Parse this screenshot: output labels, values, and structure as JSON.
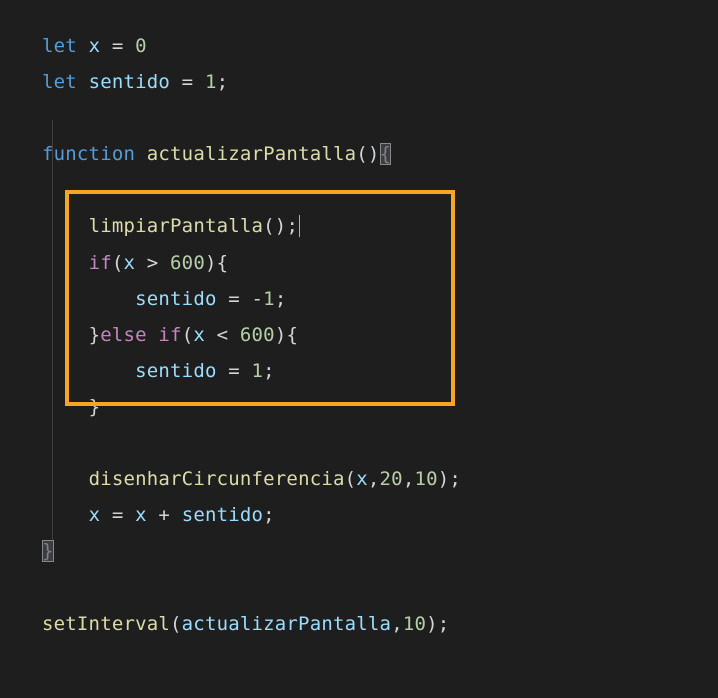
{
  "code": {
    "l1_let": "let",
    "l1_var": "x",
    "l1_eq": " = ",
    "l1_val": "0",
    "l2_let": "let",
    "l2_var": "sentido",
    "l2_eq": " = ",
    "l2_val": "1",
    "l2_semi": ";",
    "l4_func": "function",
    "l4_name": "actualizarPantalla",
    "l4_parens": "()",
    "l4_brace": "{",
    "l6_call": "limpiarPantalla",
    "l6_parens": "()",
    "l6_semi": ";",
    "l7_if": "if",
    "l7_open": "(",
    "l7_var": "x",
    "l7_op": " > ",
    "l7_num": "600",
    "l7_close": ")",
    "l7_brace": "{",
    "l8_var": "sentido",
    "l8_eq": " = ",
    "l8_neg": "-",
    "l8_val": "1",
    "l8_semi": ";",
    "l9_close": "}",
    "l9_else": "else",
    "l9_if": "if",
    "l9_open": "(",
    "l9_var": "x",
    "l9_op": " < ",
    "l9_num": "600",
    "l9_closep": ")",
    "l9_brace": "{",
    "l10_var": "sentido",
    "l10_eq": " = ",
    "l10_val": "1",
    "l10_semi": ";",
    "l11_close": "}",
    "l13_call": "disenharCircunferencia",
    "l13_open": "(",
    "l13_arg1": "x",
    "l13_c1": ",",
    "l13_arg2": "20",
    "l13_c2": ",",
    "l13_arg3": "10",
    "l13_close": ")",
    "l13_semi": ";",
    "l14_var1": "x",
    "l14_eq": " = ",
    "l14_var2": "x",
    "l14_plus": " + ",
    "l14_var3": "sentido",
    "l14_semi": ";",
    "l15_close": "}",
    "l17_call": "setInterval",
    "l17_open": "(",
    "l17_arg1": "actualizarPantalla",
    "l17_c1": ",",
    "l17_arg2": "10",
    "l17_close": ")",
    "l17_semi": ";"
  },
  "highlight": {
    "color": "#f5a623"
  }
}
